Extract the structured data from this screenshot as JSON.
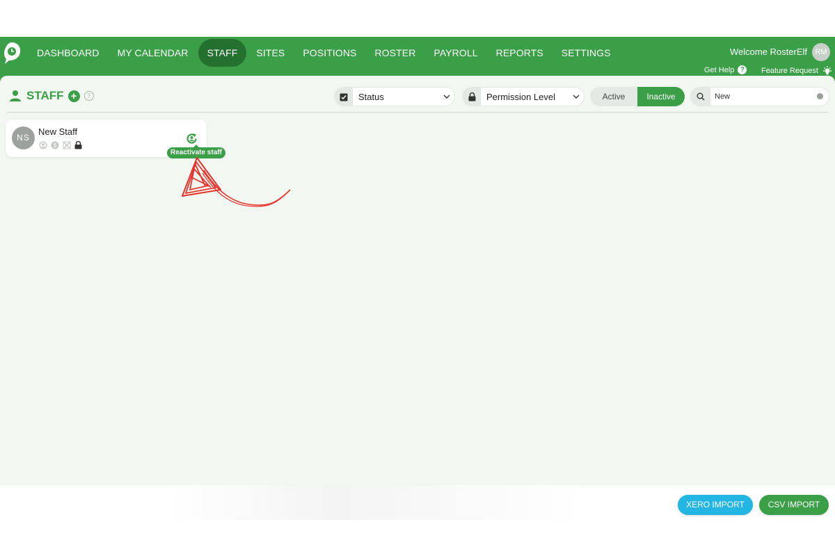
{
  "nav": {
    "items": [
      {
        "label": "DASHBOARD"
      },
      {
        "label": "MY CALENDAR"
      },
      {
        "label": "STAFF"
      },
      {
        "label": "SITES"
      },
      {
        "label": "POSITIONS"
      },
      {
        "label": "ROSTER"
      },
      {
        "label": "PAYROLL"
      },
      {
        "label": "REPORTS"
      },
      {
        "label": "SETTINGS"
      }
    ],
    "active_index": 2
  },
  "user": {
    "welcome": "Welcome RosterElf",
    "initials": "RM",
    "get_help": "Get Help",
    "feature_request": "Feature Request"
  },
  "toolbar": {
    "title": "STAFF",
    "status_select": "Status",
    "permission_select": "Permission Level",
    "toggle_active": "Active",
    "toggle_inactive": "Inactive",
    "toggle_selected": "Inactive",
    "search_value": "New"
  },
  "staff_card": {
    "initials": "NS",
    "name": "New Staff",
    "tooltip": "Reactivate staff"
  },
  "footer": {
    "xero_import": "XERO IMPORT",
    "csv_import": "CSV IMPORT"
  },
  "colors": {
    "brand_green": "#3a9f47",
    "active_tab": "#24702f",
    "xero_blue": "#24b6e3",
    "annotation_red": "#e8322c"
  }
}
